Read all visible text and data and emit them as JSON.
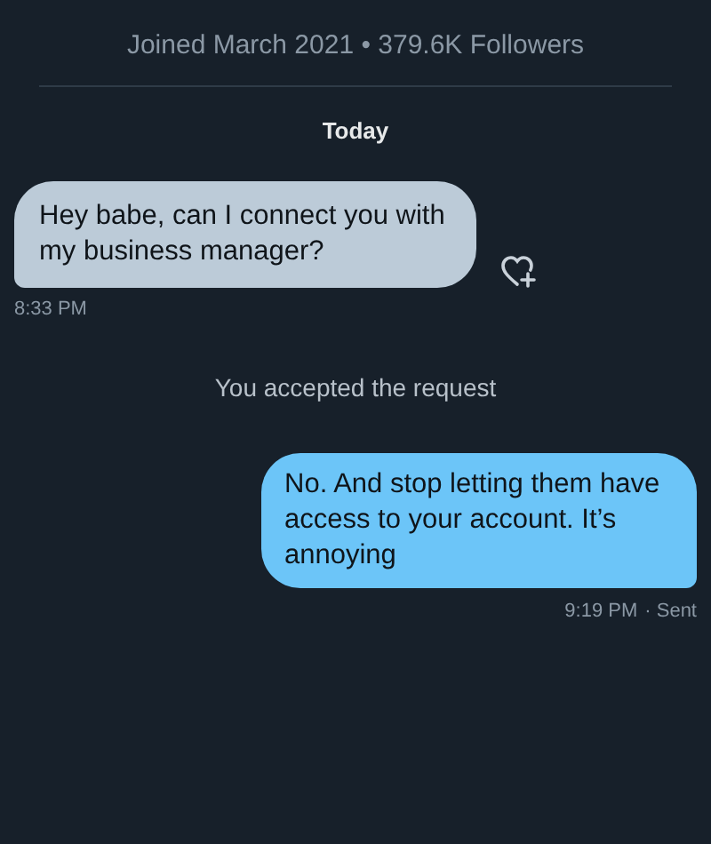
{
  "profile": {
    "joined": "Joined March 2021 • 379.6K Followers"
  },
  "date_divider": "Today",
  "messages": [
    {
      "kind": "incoming",
      "text": "Hey babe, can I connect you with my business manager?",
      "time": "8:33 PM"
    },
    {
      "kind": "notice",
      "text": "You accepted the request"
    },
    {
      "kind": "outgoing",
      "text": "No. And stop letting them have access to your account. It’s annoying",
      "time": "9:19 PM",
      "status": "· Sent"
    }
  ]
}
